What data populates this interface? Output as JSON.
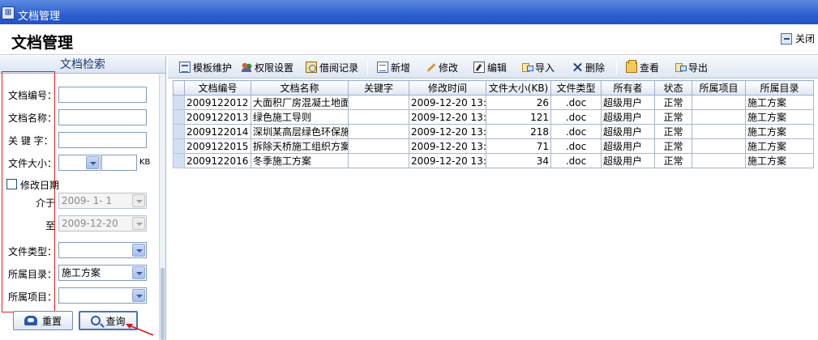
{
  "window": {
    "title": "文档管理"
  },
  "header": {
    "page_title": "文档管理",
    "close_label": "关闭"
  },
  "search_panel": {
    "title": "文档检索",
    "fields": {
      "doc_no_label": "文档编号：",
      "doc_name_label": "文档名称：",
      "keyword_label": "关 键 字：",
      "file_size_label": "文件大小：",
      "size_unit": "KB",
      "modify_date_label": "修改日期",
      "between_label": "介于",
      "to_label": "至",
      "date_from": "2009- 1- 1",
      "date_to": "2009-12-20",
      "file_type_label": "文件类型：",
      "directory_label": "所属目录：",
      "directory_value": "施工方案",
      "project_label": "所属项目："
    },
    "reset_label": "重置",
    "search_label": "查询"
  },
  "toolbar": {
    "template": "模板维护",
    "permissions": "权限设置",
    "borrow": "借阅记录",
    "add": "新增",
    "modify": "修改",
    "edit": "编辑",
    "import": "导入",
    "delete": "删除",
    "view": "查看",
    "export": "导出"
  },
  "table": {
    "columns": [
      "文档编号",
      "文档名称",
      "关键字",
      "修改时间",
      "文件大小(KB)",
      "文件类型",
      "所有者",
      "状态",
      "所属项目",
      "所属目录"
    ],
    "rows": [
      [
        "2009122012",
        "大面积厂房混凝土地面",
        "",
        "2009-12-20 13:4",
        "26",
        ".doc",
        "超级用户",
        "正常",
        "",
        "施工方案"
      ],
      [
        "2009122013",
        "绿色施工导则",
        "",
        "2009-12-20 13:4",
        "121",
        ".doc",
        "超级用户",
        "正常",
        "",
        "施工方案"
      ],
      [
        "2009122014",
        "深圳某高层绿色环保施",
        "",
        "2009-12-20 13:4",
        "218",
        ".doc",
        "超级用户",
        "正常",
        "",
        "施工方案"
      ],
      [
        "2009122015",
        "拆除天桥施工组织方案",
        "",
        "2009-12-20 13:5",
        "71",
        ".doc",
        "超级用户",
        "正常",
        "",
        "施工方案"
      ],
      [
        "2009122016",
        "冬季施工方案",
        "",
        "2009-12-20 13:5",
        "34",
        ".doc",
        "超级用户",
        "正常",
        "",
        "施工方案"
      ]
    ]
  },
  "colors": {
    "titlebar": "#2d5fd0",
    "highlight_box": "#e02020",
    "row_selector": "#d2e0f3"
  }
}
